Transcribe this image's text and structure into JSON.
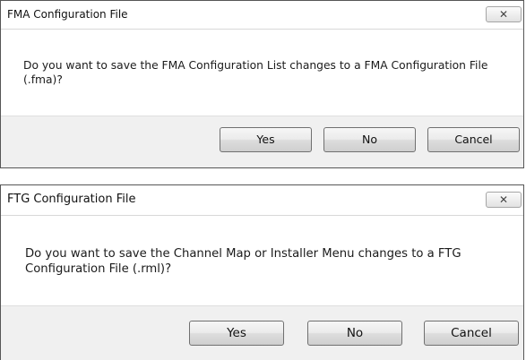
{
  "dialogs": [
    {
      "title": "FMA Configuration File",
      "close_glyph": "✕",
      "message": "Do you want to save the FMA Configuration List changes to a FMA Configuration File (.fma)?",
      "buttons": {
        "yes": "Yes",
        "no": "No",
        "cancel": "Cancel"
      }
    },
    {
      "title": "FTG Configuration File",
      "close_glyph": "✕",
      "message": "Do you want to save the Channel Map or Installer Menu changes to a FTG Configuration File (.rml)?",
      "buttons": {
        "yes": "Yes",
        "no": "No",
        "cancel": "Cancel"
      }
    }
  ]
}
